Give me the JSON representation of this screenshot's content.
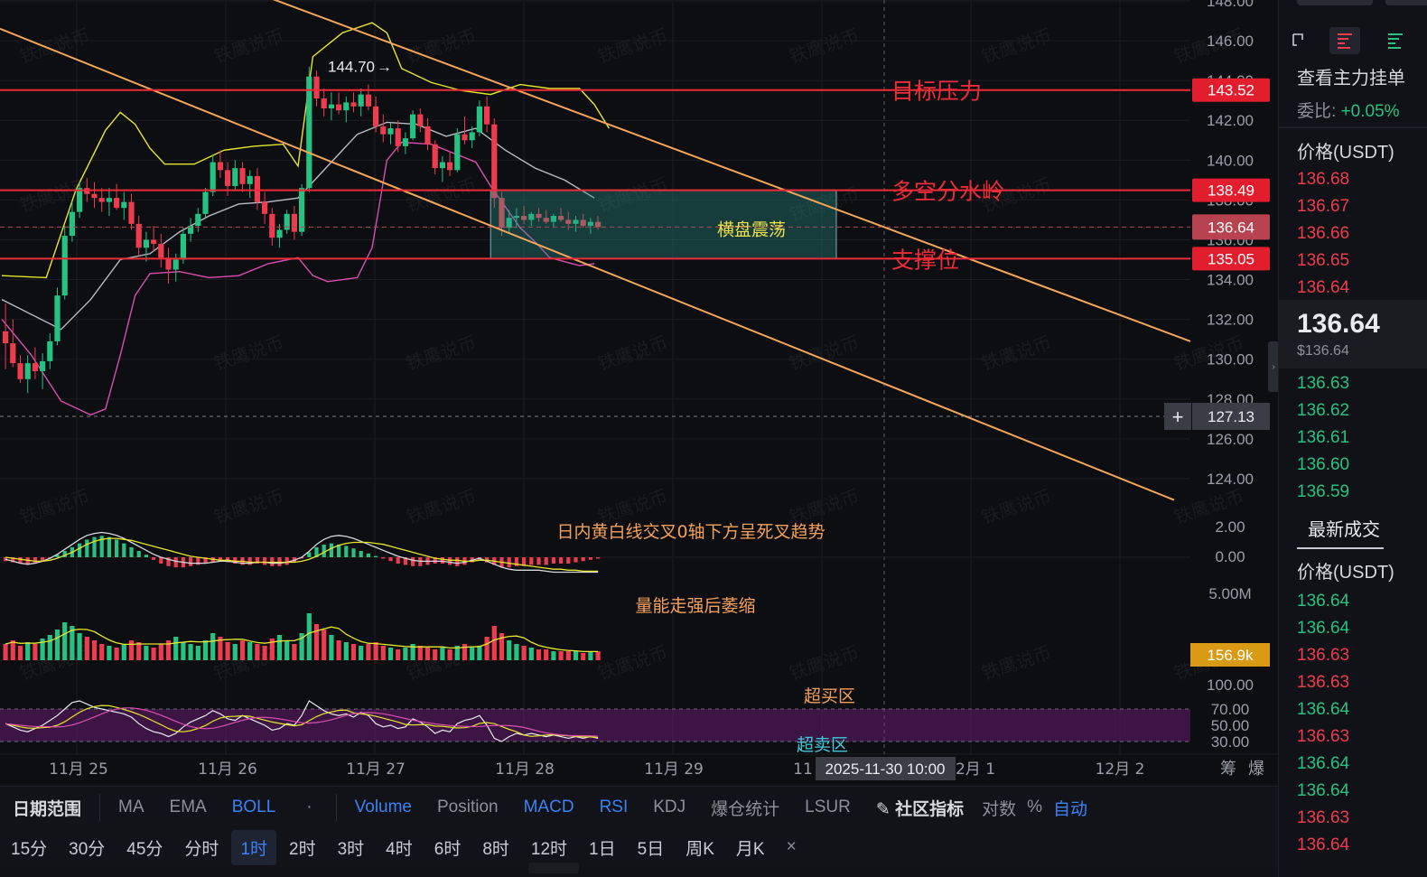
{
  "watermark": "铁鹰说币",
  "chart_data": {
    "type": "candlestick",
    "price_axis": {
      "ylim": [
        123,
        148
      ],
      "ticks": [
        "148.00",
        "146.00",
        "144.00",
        "142.00",
        "140.00",
        "138.00",
        "136.00",
        "134.00",
        "132.00",
        "130.00",
        "128.00",
        "126.00",
        "124.00"
      ]
    },
    "x_labels": [
      "11月 25",
      "11月 26",
      "11月 27",
      "11月 28",
      "11月 29",
      "11",
      "2月 1",
      "12月 2"
    ],
    "x_right_labels": [
      "筹",
      "爆"
    ],
    "hover_time": "2025-11-30 10:00",
    "high_marker": "144.70",
    "levels": [
      {
        "name": "目标压力",
        "value": 143.52,
        "label": "143.52"
      },
      {
        "name": "多空分水岭",
        "value": 138.49,
        "label": "138.49"
      },
      {
        "name": "支撑位",
        "value": 135.05,
        "label": "135.05"
      }
    ],
    "current_price": {
      "value": 136.64,
      "label": "136.64"
    },
    "crosshair_price": {
      "value": 127.13,
      "label": "127.13"
    },
    "box_label": "横盘震荡",
    "channel_upper": [
      [
        0,
        153.2
      ],
      [
        131,
        130.9
      ]
    ],
    "channel_lower": [
      [
        0,
        146.6
      ],
      [
        131,
        123.2
      ]
    ],
    "candles": [
      [
        131.4,
        132.8,
        129.5,
        130.8
      ],
      [
        130.8,
        132.0,
        129.6,
        129.8
      ],
      [
        129.8,
        130.2,
        128.8,
        129.0
      ],
      [
        129.0,
        130.2,
        128.3,
        129.8
      ],
      [
        129.8,
        130.6,
        129.0,
        129.4
      ],
      [
        129.4,
        130.3,
        128.5,
        129.9
      ],
      [
        129.9,
        131.3,
        129.5,
        130.9
      ],
      [
        130.9,
        133.6,
        130.7,
        133.2
      ],
      [
        133.2,
        136.7,
        133.0,
        136.2
      ],
      [
        136.2,
        137.9,
        135.9,
        137.4
      ],
      [
        137.4,
        138.9,
        137.1,
        138.6
      ],
      [
        138.6,
        139.1,
        137.9,
        138.3
      ],
      [
        138.3,
        138.9,
        137.6,
        138.1
      ],
      [
        138.1,
        138.6,
        137.4,
        137.9
      ],
      [
        137.9,
        138.6,
        137.2,
        138.1
      ],
      [
        138.1,
        138.8,
        137.5,
        137.6
      ],
      [
        137.6,
        138.4,
        137.0,
        137.9
      ],
      [
        137.9,
        138.3,
        136.5,
        136.8
      ],
      [
        136.8,
        137.2,
        135.2,
        135.6
      ],
      [
        135.6,
        136.4,
        134.9,
        136.0
      ],
      [
        136.0,
        136.7,
        135.4,
        135.8
      ],
      [
        135.8,
        136.3,
        134.6,
        135.1
      ],
      [
        135.1,
        135.6,
        133.8,
        134.5
      ],
      [
        134.5,
        135.3,
        133.9,
        135.0
      ],
      [
        135.0,
        136.6,
        134.8,
        136.3
      ],
      [
        136.3,
        137.1,
        135.9,
        136.7
      ],
      [
        136.7,
        137.6,
        136.4,
        137.3
      ],
      [
        137.3,
        138.6,
        137.1,
        138.4
      ],
      [
        138.4,
        140.3,
        138.2,
        139.9
      ],
      [
        139.9,
        140.5,
        139.1,
        139.5
      ],
      [
        139.5,
        139.9,
        138.2,
        138.7
      ],
      [
        138.7,
        140.0,
        138.5,
        139.6
      ],
      [
        139.6,
        139.9,
        138.4,
        138.8
      ],
      [
        138.8,
        139.5,
        138.1,
        139.2
      ],
      [
        139.2,
        139.6,
        137.5,
        137.9
      ],
      [
        137.9,
        138.4,
        136.8,
        137.3
      ],
      [
        137.3,
        137.6,
        135.7,
        136.1
      ],
      [
        136.1,
        136.8,
        135.6,
        136.5
      ],
      [
        136.5,
        137.5,
        136.3,
        137.3
      ],
      [
        137.3,
        137.7,
        136.0,
        136.4
      ],
      [
        136.4,
        138.8,
        136.2,
        138.6
      ],
      [
        138.6,
        144.7,
        138.4,
        144.2
      ],
      [
        144.2,
        144.5,
        142.7,
        143.1
      ],
      [
        143.1,
        143.6,
        142.2,
        142.6
      ],
      [
        142.6,
        143.4,
        142.0,
        142.8
      ],
      [
        142.8,
        143.4,
        142.3,
        142.5
      ],
      [
        142.5,
        143.2,
        141.9,
        142.9
      ],
      [
        142.9,
        143.4,
        142.4,
        142.7
      ],
      [
        142.7,
        143.6,
        142.2,
        143.3
      ],
      [
        143.3,
        143.8,
        142.5,
        142.7
      ],
      [
        142.7,
        143.2,
        141.4,
        141.7
      ],
      [
        141.7,
        142.3,
        140.9,
        141.3
      ],
      [
        141.3,
        141.9,
        140.8,
        141.6
      ],
      [
        141.6,
        142.0,
        140.4,
        140.7
      ],
      [
        140.7,
        141.4,
        140.3,
        141.1
      ],
      [
        141.1,
        142.5,
        141.0,
        142.3
      ],
      [
        142.3,
        142.6,
        141.4,
        141.7
      ],
      [
        141.7,
        142.1,
        140.5,
        140.8
      ],
      [
        140.8,
        141.0,
        139.3,
        139.6
      ],
      [
        139.6,
        140.2,
        138.9,
        139.9
      ],
      [
        139.9,
        140.4,
        139.2,
        139.5
      ],
      [
        139.5,
        141.6,
        139.4,
        141.3
      ],
      [
        141.3,
        142.2,
        140.8,
        141.0
      ],
      [
        141.0,
        141.7,
        140.6,
        141.4
      ],
      [
        141.4,
        143.0,
        141.2,
        142.7
      ],
      [
        142.7,
        143.2,
        141.4,
        141.8
      ],
      [
        141.8,
        142.1,
        137.6,
        138.1
      ],
      [
        138.1,
        138.4,
        136.2,
        136.6
      ],
      [
        136.6,
        137.5,
        136.3,
        137.1
      ],
      [
        137.1,
        137.6,
        136.6,
        137.2
      ],
      [
        137.2,
        137.7,
        136.8,
        137.0
      ],
      [
        137.0,
        137.4,
        136.7,
        137.3
      ],
      [
        137.3,
        137.6,
        136.9,
        137.1
      ],
      [
        137.1,
        137.5,
        136.8,
        136.9
      ],
      [
        136.9,
        137.3,
        136.6,
        137.2
      ],
      [
        137.2,
        137.6,
        136.9,
        137.0
      ],
      [
        137.0,
        137.4,
        136.5,
        136.8
      ],
      [
        136.8,
        137.2,
        136.4,
        137.0
      ],
      [
        137.0,
        137.3,
        136.6,
        136.7
      ],
      [
        136.7,
        137.1,
        136.3,
        136.9
      ],
      [
        136.9,
        137.2,
        136.5,
        136.64
      ]
    ],
    "boll_mid": [
      [
        0,
        133.0
      ],
      [
        8,
        131.5
      ],
      [
        12,
        133.0
      ],
      [
        16,
        135.0
      ],
      [
        20,
        135.3
      ],
      [
        24,
        136.4
      ],
      [
        28,
        137.2
      ],
      [
        32,
        137.8
      ],
      [
        36,
        137.9
      ],
      [
        40,
        138.1
      ],
      [
        44,
        139.7
      ],
      [
        48,
        141.3
      ],
      [
        52,
        141.9
      ],
      [
        56,
        141.8
      ],
      [
        60,
        141.2
      ],
      [
        64,
        141.6
      ],
      [
        68,
        140.5
      ],
      [
        72,
        139.6
      ],
      [
        76,
        139.0
      ],
      [
        80,
        138.1
      ]
    ],
    "boll_upper": [
      [
        0,
        134.2
      ],
      [
        6,
        134.1
      ],
      [
        10,
        138.5
      ],
      [
        14,
        141.5
      ],
      [
        16,
        142.4
      ],
      [
        18,
        141.8
      ],
      [
        20,
        140.6
      ],
      [
        22,
        139.8
      ],
      [
        26,
        139.8
      ],
      [
        30,
        140.5
      ],
      [
        34,
        140.7
      ],
      [
        38,
        140.8
      ],
      [
        40,
        139.7
      ],
      [
        42,
        145.2
      ],
      [
        46,
        146.4
      ],
      [
        50,
        146.9
      ],
      [
        52,
        146.4
      ],
      [
        54,
        144.6
      ],
      [
        58,
        143.9
      ],
      [
        62,
        143.5
      ],
      [
        66,
        143.3
      ],
      [
        70,
        143.8
      ],
      [
        74,
        143.6
      ],
      [
        78,
        143.6
      ],
      [
        80,
        142.8
      ],
      [
        82,
        141.6
      ]
    ],
    "boll_lower": [
      [
        0,
        132.0
      ],
      [
        4,
        130.2
      ],
      [
        8,
        127.9
      ],
      [
        12,
        127.2
      ],
      [
        14,
        127.5
      ],
      [
        16,
        130.2
      ],
      [
        18,
        133.2
      ],
      [
        20,
        134.3
      ],
      [
        24,
        134.4
      ],
      [
        28,
        134.1
      ],
      [
        32,
        134.2
      ],
      [
        36,
        134.8
      ],
      [
        40,
        135.1
      ],
      [
        42,
        134.2
      ],
      [
        44,
        133.9
      ],
      [
        48,
        134.1
      ],
      [
        50,
        135.6
      ],
      [
        52,
        140.0
      ],
      [
        54,
        140.9
      ],
      [
        58,
        140.8
      ],
      [
        62,
        140.2
      ],
      [
        64,
        139.9
      ],
      [
        66,
        138.7
      ],
      [
        70,
        136.6
      ],
      [
        72,
        135.9
      ],
      [
        74,
        135.1
      ],
      [
        78,
        134.7
      ],
      [
        80,
        134.8
      ]
    ],
    "macd": {
      "label": "日内黄白线交叉0轴下方呈死叉趋势",
      "ticks": [
        "2.00",
        "0.00"
      ]
    },
    "volume": {
      "label": "量能走强后萎缩",
      "ticks": [
        "5.00M"
      ],
      "badge": "156.9k"
    },
    "rsi": {
      "overbought_label": "超买区",
      "oversold_label": "超卖区",
      "ticks": [
        "100.00",
        "70.00",
        "50.00",
        "30.00"
      ]
    }
  },
  "toolbar1": {
    "items": [
      "日期范围",
      "MA",
      "EMA",
      "BOLL",
      "Volume",
      "Position",
      "MACD",
      "RSI",
      "KDJ",
      "爆仓统计",
      "LSUR",
      "社区指标",
      "对数",
      "%",
      "自动"
    ]
  },
  "toolbar2": {
    "items": [
      "15分",
      "30分",
      "45分",
      "分时",
      "1时",
      "2时",
      "3时",
      "4时",
      "6时",
      "8时",
      "12时",
      "1日",
      "5日",
      "周K",
      "月K"
    ],
    "selected": "1时",
    "close": "×"
  },
  "panel": {
    "title": "查看主力挂单",
    "ratio_label": "委比:",
    "ratio_value": "+0.05%",
    "price_header": "价格(USDT)",
    "asks": [
      "136.68",
      "136.67",
      "136.66",
      "136.65",
      "136.64"
    ],
    "last_price": "136.64",
    "last_price_usd": "$136.64",
    "bids": [
      "136.63",
      "136.62",
      "136.61",
      "136.60",
      "136.59"
    ],
    "trades_title": "最新成交",
    "trades_header": "价格(USDT)",
    "trades": [
      [
        "136.64",
        "up"
      ],
      [
        "136.64",
        "up"
      ],
      [
        "136.63",
        "dn"
      ],
      [
        "136.63",
        "dn"
      ],
      [
        "136.64",
        "up"
      ],
      [
        "136.63",
        "dn"
      ],
      [
        "136.64",
        "up"
      ],
      [
        "136.64",
        "up"
      ],
      [
        "136.63",
        "dn"
      ],
      [
        "136.64",
        "dn"
      ]
    ],
    "colors": {
      "up": "#26c281",
      "down": "#ef3b4e"
    }
  }
}
